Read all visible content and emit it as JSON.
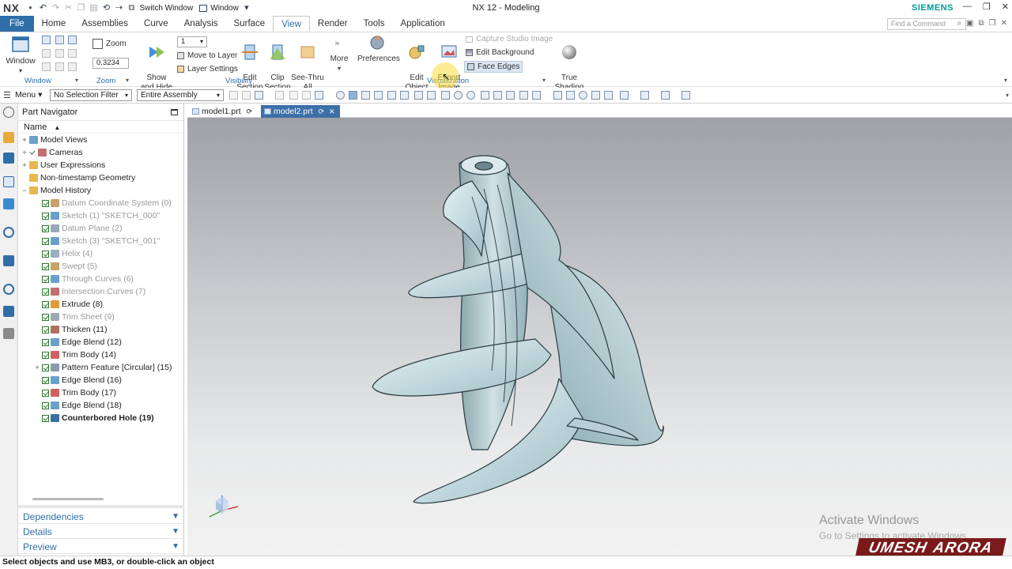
{
  "app": {
    "logo": "NX",
    "window_title": "NX 12 - Modeling",
    "brand": "SIEMENS",
    "switch_window": "Switch Window",
    "window_menu": "Window"
  },
  "tabs": [
    "File",
    "Home",
    "Assemblies",
    "Curve",
    "Analysis",
    "Surface",
    "View",
    "Render",
    "Tools",
    "Application"
  ],
  "active_tab": "View",
  "find_command_placeholder": "Find a Command",
  "ribbon": {
    "window_label": "Window",
    "window_group": "Window",
    "zoom_label": "Zoom",
    "zoom_value": "0.3234",
    "zoom_group": "Zoom",
    "layer_value": "1",
    "show_hide": "Show\nand Hide",
    "move_to_layer": "Move to Layer",
    "layer_settings": "Layer Settings",
    "edit_section": "Edit\nSection",
    "clip_section": "Clip\nSection",
    "see_thru_all": "See-Thru\nAll",
    "more": "More",
    "visibility_group": "Visibility",
    "preferences": "Preferences",
    "edit_object_display": "Edit Object\nDisplay",
    "export_image": "Export\nImage",
    "capture_studio_image": "Capture Studio Image",
    "edit_background": "Edit Background",
    "face_edges": "Face Edges",
    "visualization_group": "Visualization",
    "true_shading": "True\nShading"
  },
  "toolbar": {
    "menu": "Menu",
    "selection_filter": "No Selection Filter",
    "assembly_scope": "Entire Assembly"
  },
  "navigator": {
    "title": "Part Navigator",
    "column_name": "Name",
    "items": [
      {
        "label": "Model Views",
        "level": 0,
        "expander": "+",
        "state": "normal"
      },
      {
        "label": "Cameras",
        "level": 0,
        "expander": "+",
        "state": "normal"
      },
      {
        "label": "User Expressions",
        "level": 0,
        "expander": "+",
        "state": "normal"
      },
      {
        "label": "Non-timestamp Geometry",
        "level": 0,
        "expander": "",
        "state": "normal"
      },
      {
        "label": "Model History",
        "level": 0,
        "expander": "−",
        "state": "normal"
      },
      {
        "label": "Datum Coordinate System (0)",
        "level": 1,
        "state": "grey"
      },
      {
        "label": "Sketch (1) \"SKETCH_000\"",
        "level": 1,
        "state": "grey"
      },
      {
        "label": "Datum Plane (2)",
        "level": 1,
        "state": "grey"
      },
      {
        "label": "Sketch (3) \"SKETCH_001\"",
        "level": 1,
        "state": "grey"
      },
      {
        "label": "Helix (4)",
        "level": 1,
        "state": "grey"
      },
      {
        "label": "Swept (5)",
        "level": 1,
        "state": "grey"
      },
      {
        "label": "Through Curves (6)",
        "level": 1,
        "state": "grey"
      },
      {
        "label": "Intersection Curves (7)",
        "level": 1,
        "state": "grey"
      },
      {
        "label": "Extrude (8)",
        "level": 1,
        "state": "normal"
      },
      {
        "label": "Trim Sheet (9)",
        "level": 1,
        "state": "grey"
      },
      {
        "label": "Thicken (11)",
        "level": 1,
        "state": "normal"
      },
      {
        "label": "Edge Blend (12)",
        "level": 1,
        "state": "normal"
      },
      {
        "label": "Trim Body (14)",
        "level": 1,
        "state": "normal"
      },
      {
        "label": "Pattern Feature [Circular] (15)",
        "level": 1,
        "expander": "+",
        "state": "normal"
      },
      {
        "label": "Edge Blend (16)",
        "level": 1,
        "state": "normal"
      },
      {
        "label": "Trim Body (17)",
        "level": 1,
        "state": "normal"
      },
      {
        "label": "Edge Blend (18)",
        "level": 1,
        "state": "normal"
      },
      {
        "label": "Counterbored Hole (19)",
        "level": 1,
        "state": "bold"
      }
    ],
    "panels": [
      "Dependencies",
      "Details",
      "Preview"
    ]
  },
  "documents": {
    "tab1": "model1.prt",
    "tab2": "model2.prt"
  },
  "viewport": {
    "watermark_title": "Activate Windows",
    "watermark_sub": "Go to Settings to activate Windows.",
    "brand_first": "UMESH",
    "brand_last": "ARORA"
  },
  "status": "Select objects and use MB3, or double-click an object",
  "colors": {
    "accent": "#2f6ea8",
    "siemens": "#009999",
    "model_face": "#c7dde2",
    "model_edge": "#2a3a40"
  }
}
